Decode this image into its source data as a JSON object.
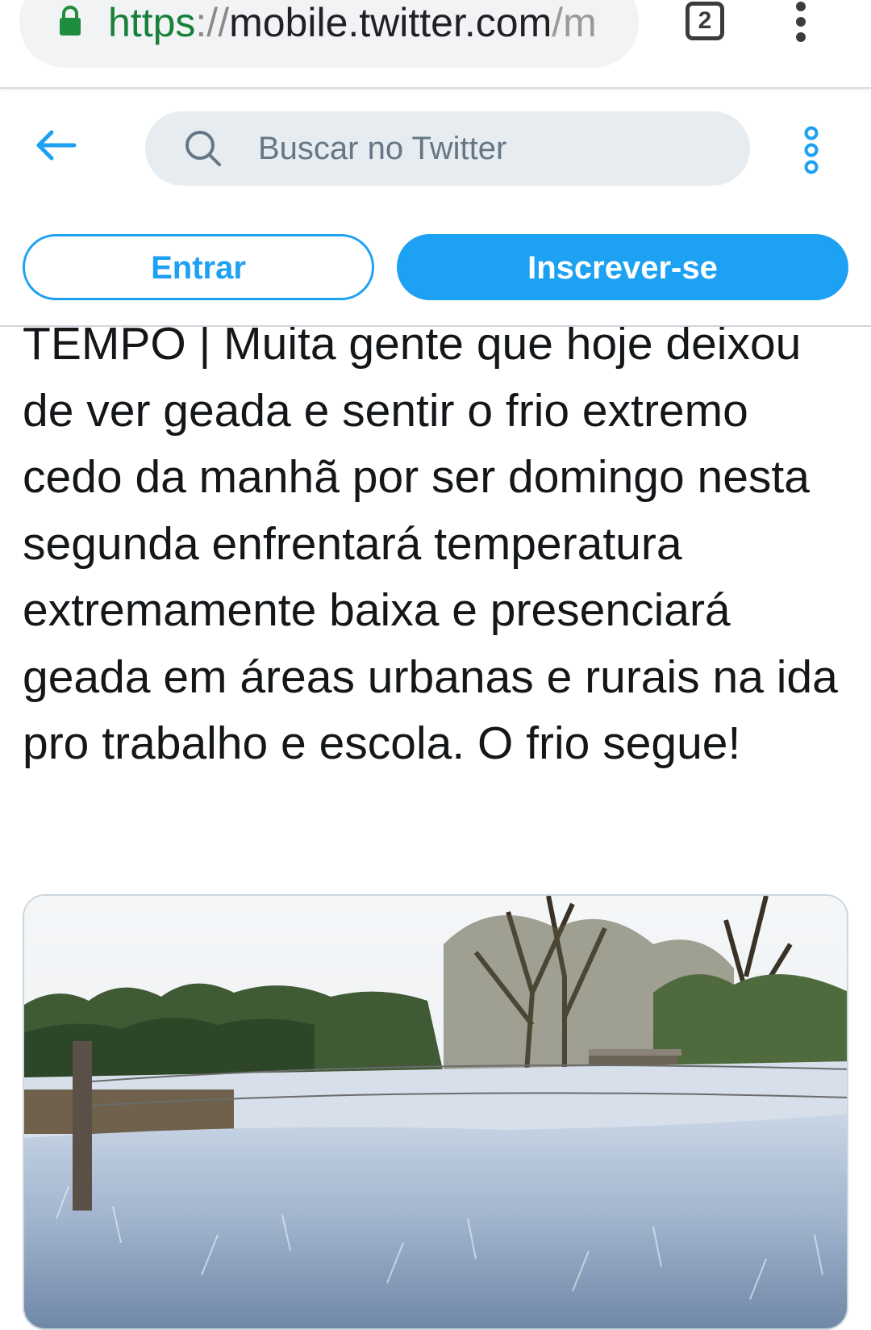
{
  "browser": {
    "url_scheme": "https",
    "url_sep": "://",
    "url_host": "mobile.twitter.com",
    "url_path": "/m",
    "tab_count": "2",
    "icons": {
      "lock": "lock-icon",
      "menu": "vertical-dots-icon"
    },
    "colors": {
      "lock": "#1e8e3e",
      "scheme": "#188038"
    }
  },
  "header": {
    "search_placeholder": "Buscar no Twitter",
    "icons": {
      "back": "back-arrow-icon",
      "search": "search-icon",
      "more": "more-options-icon"
    }
  },
  "auth": {
    "login_label": "Entrar",
    "signup_label": "Inscrever-se"
  },
  "tweet": {
    "text": "TEMPO | Muita gente que hoje deixou de ver geada e sentir o frio extremo cedo da manhã por ser domingo nesta segunda enfrentará temperatura extremamente baixa e presenciará geada em áreas urbanas e rurais na ida pro trabalho e escola. O frio segue!"
  },
  "colors": {
    "accent": "#1da1f2",
    "text": "#14171a",
    "search_bg": "#e6ecf0"
  }
}
